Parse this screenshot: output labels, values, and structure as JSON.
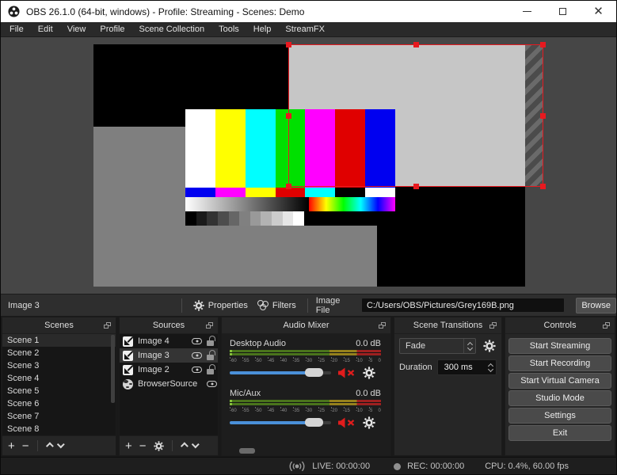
{
  "window": {
    "title": "OBS 26.1.0 (64-bit, windows) - Profile: Streaming - Scenes: Demo"
  },
  "menu": {
    "items": [
      "File",
      "Edit",
      "View",
      "Profile",
      "Scene Collection",
      "Tools",
      "Help",
      "StreamFX"
    ]
  },
  "preview": {
    "selected_source_color": "#c6c6c6",
    "canvas_background": "#000000",
    "gray_rect_color": "#7f7f7f",
    "selection_color": "#e8191f",
    "test_pattern": {
      "bars": [
        "#ffffff",
        "#ffff00",
        "#00ffff",
        "#00e000",
        "#ff00ff",
        "#e00000",
        "#0000f0"
      ],
      "castellations": [
        "#0000f0",
        "#ff00ff",
        "#ffff00",
        "#e00000",
        "#00ffff",
        "#000000",
        "#ffffff"
      ]
    }
  },
  "properties_bar": {
    "source_label": "Image 3",
    "properties_label": "Properties",
    "filters_label": "Filters",
    "image_file_label": "Image File",
    "image_file_value": "C:/Users/OBS/Pictures/Grey169B.png",
    "browse_label": "Browse"
  },
  "scenes": {
    "title": "Scenes",
    "items": [
      {
        "label": "Scene 1",
        "selected": true
      },
      {
        "label": "Scene 2",
        "selected": false
      },
      {
        "label": "Scene 3",
        "selected": false
      },
      {
        "label": "Scene 4",
        "selected": false
      },
      {
        "label": "Scene 5",
        "selected": false
      },
      {
        "label": "Scene 6",
        "selected": false
      },
      {
        "label": "Scene 7",
        "selected": false
      },
      {
        "label": "Scene 8",
        "selected": false
      }
    ]
  },
  "sources": {
    "title": "Sources",
    "items": [
      {
        "label": "Image 4",
        "icon": "image",
        "selected": false
      },
      {
        "label": "Image 3",
        "icon": "image",
        "selected": true
      },
      {
        "label": "Image 2",
        "icon": "image",
        "selected": false
      },
      {
        "label": "BrowserSource",
        "icon": "globe",
        "selected": false
      }
    ]
  },
  "audio_mixer": {
    "title": "Audio Mixer",
    "ticks": [
      "-60",
      "-55",
      "-50",
      "-45",
      "-40",
      "-35",
      "-30",
      "-25",
      "-20",
      "-15",
      "-10",
      "-5",
      "0"
    ],
    "channels": [
      {
        "name": "Desktop Audio",
        "level": "0.0 dB",
        "muted": true
      },
      {
        "name": "Mic/Aux",
        "level": "0.0 dB",
        "muted": true
      }
    ]
  },
  "transitions": {
    "title": "Scene Transitions",
    "selected_transition": "Fade",
    "duration_label": "Duration",
    "duration_value": "300 ms"
  },
  "controls": {
    "title": "Controls",
    "buttons": [
      "Start Streaming",
      "Start Recording",
      "Start Virtual Camera",
      "Studio Mode",
      "Settings",
      "Exit"
    ]
  },
  "status_bar": {
    "live": "LIVE: 00:00:00",
    "rec": "REC: 00:00:00",
    "stats": "CPU: 0.4%, 60.00 fps"
  }
}
